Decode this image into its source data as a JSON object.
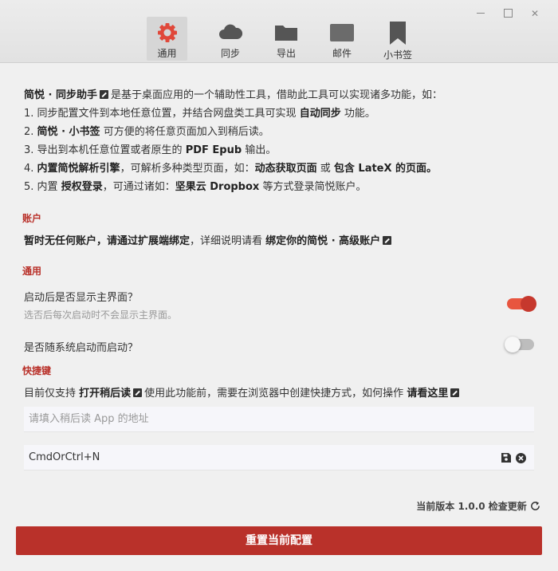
{
  "tabs": [
    {
      "label": "通用",
      "icon": "gear-icon",
      "active": true
    },
    {
      "label": "同步",
      "icon": "cloud-icon"
    },
    {
      "label": "导出",
      "icon": "folder-icon"
    },
    {
      "label": "邮件",
      "icon": "mail-icon"
    },
    {
      "label": "小书签",
      "icon": "bookmark-icon"
    }
  ],
  "intro": {
    "l1": {
      "b": "简悦 · 同步助手",
      "t": "是基于桌面应用的一个辅助性工具，借助此工具可以实现诸多功能，如："
    },
    "l2": {
      "a": "1. 同步配置文件到本地任意位置，并结合网盘类工具可实现",
      "b": "自动同步",
      "c": "功能。"
    },
    "l3": {
      "a": "2.",
      "b": "简悦 · 小书签",
      "c": "可方便的将任意页面加入到稍后读。"
    },
    "l4": {
      "a": "3. 导出到本机任意位置或者原生的",
      "b": "PDF Epub",
      "c": "输出。"
    },
    "l5": {
      "a": "4.",
      "b": "内置简悦解析引擎",
      "c": "，可解析多种类型页面，如：",
      "d": "动态获取页面",
      "e": "或",
      "f": "包含 LateX 的页面。"
    },
    "l6": {
      "a": "5. 内置",
      "b": "授权登录",
      "c": "，可通过诸如：",
      "d": "坚果云 Dropbox",
      "e": "等方式登录简悦账户。"
    }
  },
  "account": {
    "section": "账户",
    "a": "暂时无任何账户，请通过扩展端绑定",
    "b": "，详细说明请看",
    "c": "绑定你的简悦 · 高级账户"
  },
  "general": {
    "section": "通用",
    "opt1_title": "启动后是否显示主界面？",
    "opt1_sub": "选否后每次启动时不会显示主界面。",
    "opt1_on": true,
    "opt2_title": "是否随系统启动而启动？",
    "opt2_on": false
  },
  "shortcut": {
    "section": "快捷键",
    "a": "目前仅支持",
    "b": "打开稍后读",
    "c": "使用此功能前，需要在浏览器中创建快捷方式，如何操作",
    "d": "请看这里",
    "placeholder": "请填入稍后读 App 的地址",
    "value": "CmdOrCtrl+N"
  },
  "footer": {
    "version_label": "当前版本 1.0.0 检查更新",
    "reset_label": "重置当前配置"
  },
  "colors": {
    "accent": "#b9312a",
    "toggle_on": "#e8553f"
  }
}
